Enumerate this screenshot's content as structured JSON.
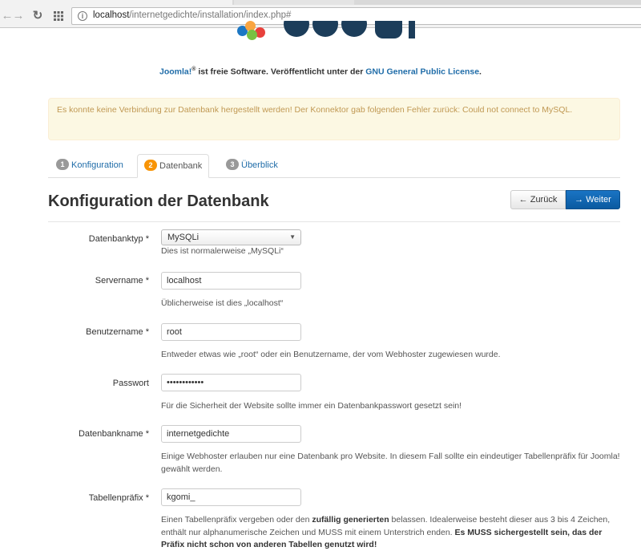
{
  "browser": {
    "url_host": "localhost",
    "url_path": "/internetgedichte/installation/index.php#"
  },
  "header": {
    "license_brand": "Joomla!",
    "license_reg": "®",
    "license_text": " ist freie Software. Veröffentlicht unter der ",
    "license_link": "GNU General Public License",
    "license_end": "."
  },
  "alert": {
    "text": "Es konnte keine Verbindung zur Datenbank hergestellt werden! Der Konnektor gab folgenden Fehler zurück: Could not connect to MySQL."
  },
  "tabs": [
    {
      "number": "1",
      "label": "Konfiguration"
    },
    {
      "number": "2",
      "label": "Datenbank"
    },
    {
      "number": "3",
      "label": "Überblick"
    }
  ],
  "title": "Konfiguration der Datenbank",
  "buttons": {
    "back": "Zurück",
    "next": "Weiter"
  },
  "form": {
    "dbtype": {
      "label": "Datenbanktyp *",
      "value": "MySQLi",
      "help": "Dies ist normalerweise „MySQLi“"
    },
    "servername": {
      "label": "Servername *",
      "value": "localhost",
      "help": "Üblicherweise ist dies „localhost“"
    },
    "username": {
      "label": "Benutzername *",
      "value": "root",
      "help": "Entweder etwas wie „root“ oder ein Benutzername, der vom Webhoster zugewiesen wurde."
    },
    "password": {
      "label": "Passwort",
      "value": "••••••••••••",
      "help": "Für die Sicherheit der Website sollte immer ein Datenbankpasswort gesetzt sein!"
    },
    "dbname": {
      "label": "Datenbankname *",
      "value": "internetgedichte",
      "help": "Einige Webhoster erlauben nur eine Datenbank pro Website. In diesem Fall sollte ein eindeutiger Tabellenpräfix für Joomla! gewählt werden."
    },
    "prefix": {
      "label": "Tabellenpräfix *",
      "value": "kgomi_",
      "help_1": "Einen Tabellenpräfix vergeben oder den ",
      "help_bold_1": "zufällig generierten",
      "help_2": " belassen. Idealerweise besteht dieser aus 3 bis 4 Zeichen, enthält nur alphanumerische Zeichen und MUSS mit einem Unterstrich enden. ",
      "help_bold_2": "Es MUSS sichergestellt sein, das der Präfix nicht schon von anderen Tabellen genutzt wird!"
    }
  },
  "colors": {
    "link": "#1f6ca8",
    "alert_bg": "#fcf8e3",
    "alert_text": "#c09853",
    "primary": "#0a5aa0",
    "active_badge": "#f89406"
  }
}
